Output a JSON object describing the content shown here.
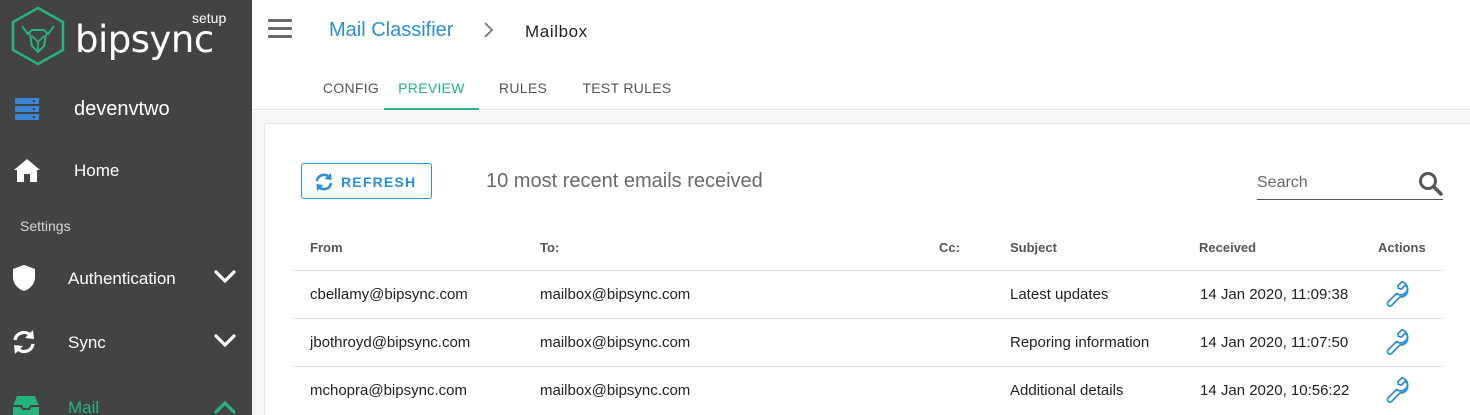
{
  "brand": {
    "name": "bipsync",
    "tag": "setup",
    "accent": "#26b47d"
  },
  "sidebar": {
    "env": "devenvtwo",
    "home": "Home",
    "settings_heading": "Settings",
    "items": [
      {
        "label": "Authentication",
        "icon": "shield-icon"
      },
      {
        "label": "Sync",
        "icon": "sync-icon"
      },
      {
        "label": "Mail",
        "icon": "inbox-icon"
      }
    ]
  },
  "header": {
    "breadcrumb_parent": "Mail Classifier",
    "breadcrumb_current": "Mailbox"
  },
  "tabs": [
    {
      "label": "CONFIG"
    },
    {
      "label": "PREVIEW",
      "active": true
    },
    {
      "label": "RULES"
    },
    {
      "label": "TEST RULES"
    }
  ],
  "toolbar": {
    "refresh_label": "REFRESH",
    "summary": "10 most recent emails received",
    "search_placeholder": "Search"
  },
  "table": {
    "columns": [
      "From",
      "To:",
      "Cc:",
      "Subject",
      "Received",
      "Actions"
    ],
    "rows": [
      {
        "from": "cbellamy@bipsync.com",
        "to": "mailbox@bipsync.com",
        "cc": "",
        "subject": "Latest updates",
        "received": "14 Jan 2020, 11:09:38"
      },
      {
        "from": "jbothroyd@bipsync.com",
        "to": "mailbox@bipsync.com",
        "cc": "",
        "subject": "Reporing information",
        "received": "14 Jan 2020, 11:07:50"
      },
      {
        "from": "mchopra@bipsync.com",
        "to": "mailbox@bipsync.com",
        "cc": "",
        "subject": "Additional details",
        "received": "14 Jan 2020, 10:56:22"
      }
    ]
  }
}
